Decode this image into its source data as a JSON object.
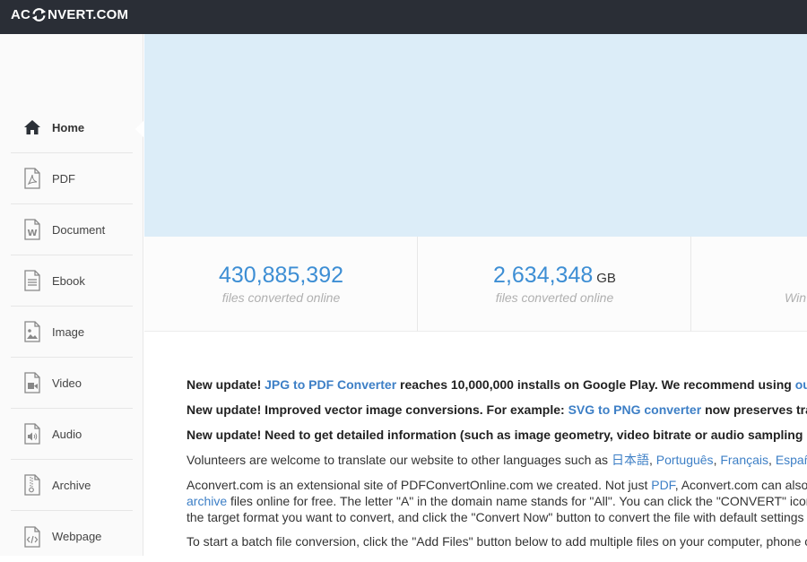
{
  "app": {
    "logo_left": "AC",
    "logo_right": "NVERT.COM"
  },
  "sidebar": {
    "items": [
      {
        "label": "Home",
        "icon": "home-icon"
      },
      {
        "label": "PDF",
        "icon": "pdf-icon"
      },
      {
        "label": "Document",
        "icon": "document-icon"
      },
      {
        "label": "Ebook",
        "icon": "ebook-icon"
      },
      {
        "label": "Image",
        "icon": "image-icon"
      },
      {
        "label": "Video",
        "icon": "video-icon"
      },
      {
        "label": "Audio",
        "icon": "audio-icon"
      },
      {
        "label": "Archive",
        "icon": "archive-icon"
      },
      {
        "label": "Webpage",
        "icon": "webpage-icon"
      }
    ],
    "active": "Home"
  },
  "stats": [
    {
      "value": "430,885,392",
      "unit": "",
      "caption": "files converted online"
    },
    {
      "value": "2,634,348",
      "unit": "GB",
      "caption": "files converted online"
    },
    {
      "value": "",
      "unit": "",
      "caption": "Win"
    }
  ],
  "content": {
    "u1": {
      "prefix": "New update!",
      "link": "JPG to PDF Converter",
      "mid": "reaches 10,000,000 installs on Google Play. We recommend using",
      "link2": "our ap"
    },
    "u2": {
      "prefix": "New update! Improved vector image conversions. For example:",
      "link": "SVG to PNG converter",
      "suffix": "now preserves tran"
    },
    "u3": {
      "text": "New update! Need to get detailed information (such as image geometry, video bitrate or audio sampling r"
    },
    "v": {
      "text": "Volunteers are welcome to translate our website to other languages such as",
      "l1": "日本語",
      "l2": "Português",
      "l3": "Français",
      "l4": "Españo"
    },
    "a": {
      "line1_pre": "Aconvert.com is an extensional site of PDFConvertOnline.com we created. Not just",
      "pdf": "PDF",
      "line1_post": ", Aconvert.com can also co",
      "archive": "archive",
      "line2_post": "files online for free. The letter \"A\" in the domain name stands for \"All\". You can click the \"CONVERT\" icon o",
      "line3": "the target format you want to convert, and click the \"Convert Now\" button to convert the file with default settings"
    },
    "b": {
      "text": "To start a batch file conversion, click the \"Add Files\" button below to add multiple files on your computer, phone o"
    }
  }
}
